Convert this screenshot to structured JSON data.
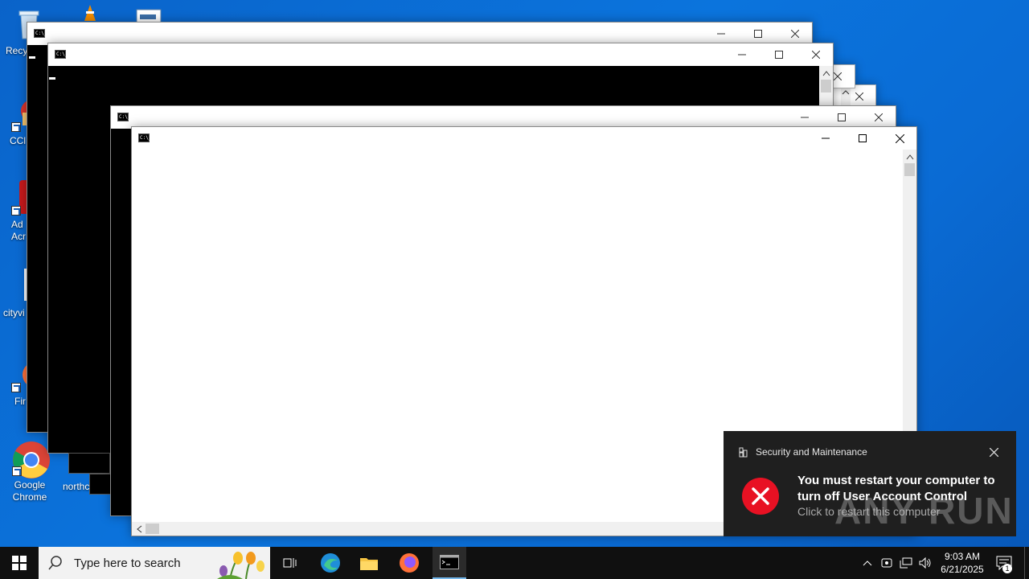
{
  "desktop": {
    "icons": [
      {
        "label": "Recy"
      },
      {
        "label": "CCl"
      },
      {
        "label": "Ad Acr"
      },
      {
        "label": "cityvi"
      },
      {
        "label": "Fir"
      },
      {
        "label": "Google Chrome"
      },
      {
        "label": "northc"
      }
    ]
  },
  "windows": {
    "glyph": "C:\\_"
  },
  "toast": {
    "app_name": "Security and Maintenance",
    "title": "You must restart your computer to turn off User Account Control",
    "body": "Click to restart this computer",
    "status_color": "#e81123"
  },
  "taskbar": {
    "search_placeholder": "Type here to search",
    "time": "9:03 AM",
    "date": "6/21/2025",
    "notification_count": "1"
  },
  "watermark": "ANY RUN"
}
